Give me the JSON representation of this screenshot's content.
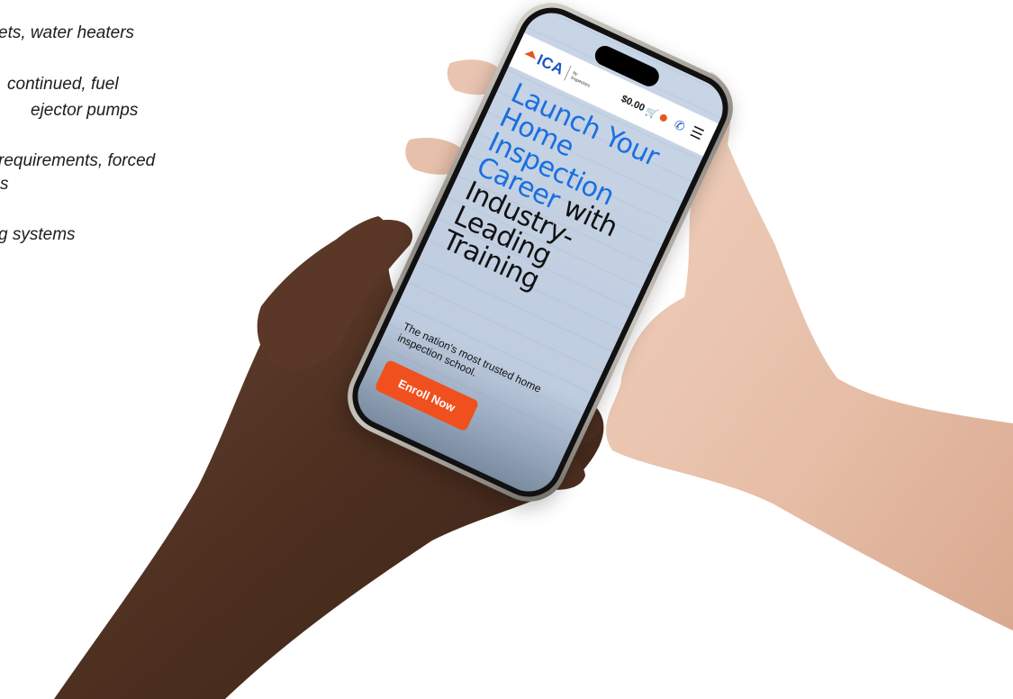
{
  "left_text": {
    "lines": [
      "ets, water heaters",
      "continued, fuel",
      "ejector pumps",
      "requirements, forced",
      "s",
      "g systems"
    ]
  },
  "phone": {
    "topbar": {
      "logo_text": "ICA",
      "logo_subtext": "by Inspectors",
      "cart_total": "$0.00",
      "cart_icon": "cart-icon",
      "phone_icon": "phone-icon",
      "menu_icon": "hamburger-menu-icon"
    },
    "hero": {
      "line1": "Launch Your",
      "line2": "Home",
      "line3": "Inspection",
      "line4a": "Career",
      "line4b": " with",
      "line5": "Industry-",
      "line6": "Leading",
      "line7": "Training"
    },
    "subtitle": "The nation's most trusted home inspection school.",
    "cta_label": "Enroll Now"
  },
  "colors": {
    "accent_blue": "#1a6fe0",
    "cta_orange": "#f0501e",
    "logo_orange": "#e8551d"
  }
}
